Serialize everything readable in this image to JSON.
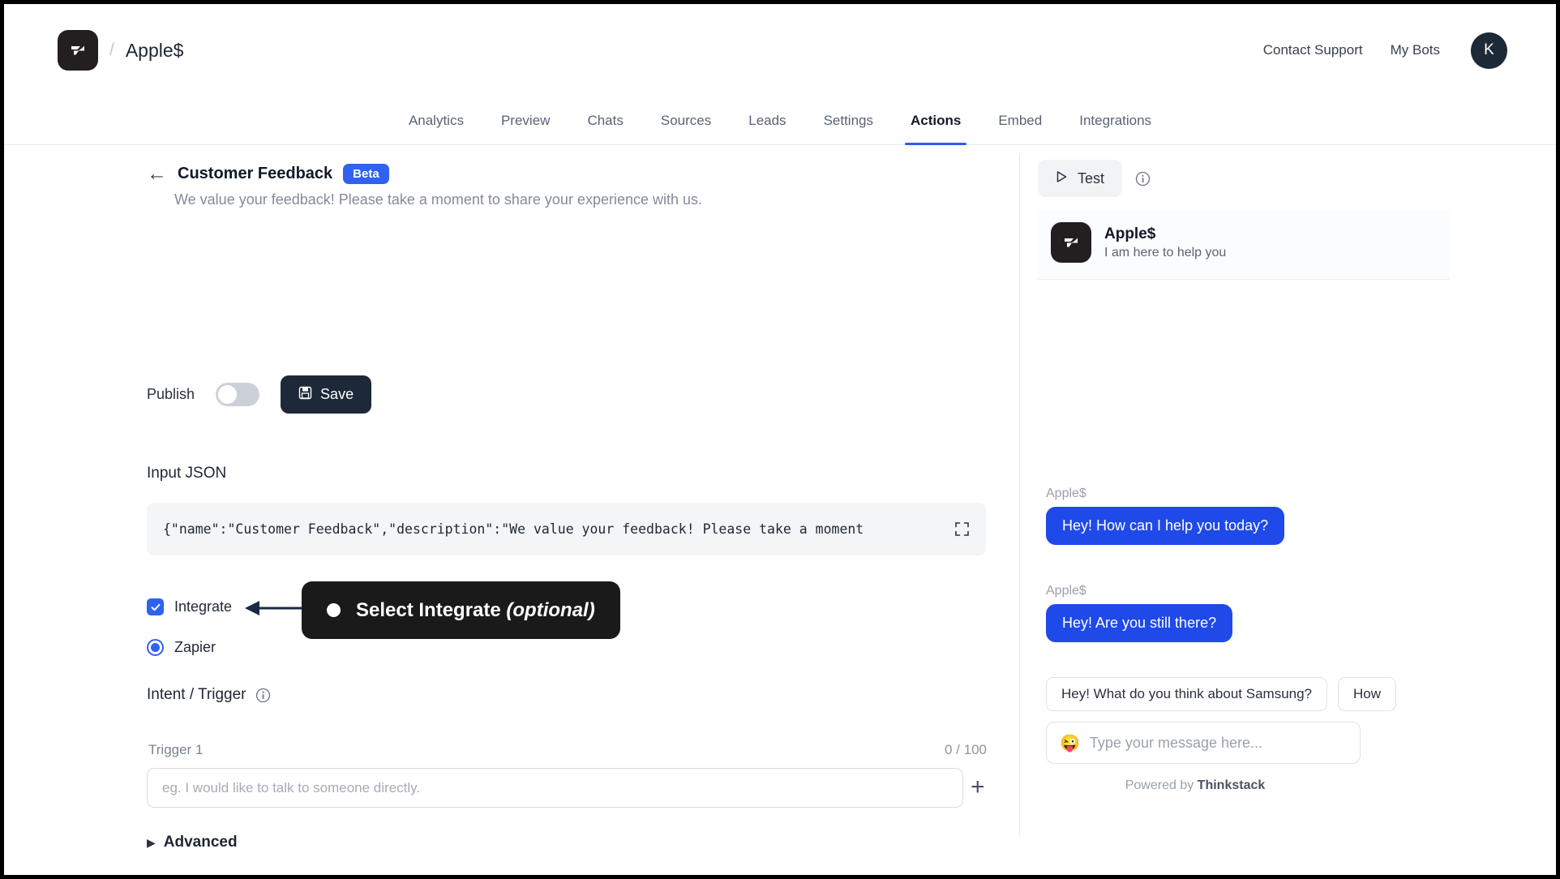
{
  "topbar": {
    "brand_name": "Apple$",
    "separator": "/",
    "logo_icon": "thinkstack-logo-icon",
    "contact_support": "Contact Support",
    "my_bots": "My Bots",
    "avatar_initial": "K"
  },
  "nav": {
    "tabs": [
      {
        "label": "Analytics",
        "active": false
      },
      {
        "label": "Preview",
        "active": false
      },
      {
        "label": "Chats",
        "active": false
      },
      {
        "label": "Sources",
        "active": false
      },
      {
        "label": "Leads",
        "active": false
      },
      {
        "label": "Settings",
        "active": false
      },
      {
        "label": "Actions",
        "active": true
      },
      {
        "label": "Embed",
        "active": false
      },
      {
        "label": "Integrations",
        "active": false
      }
    ]
  },
  "action": {
    "back_arrow": "←",
    "title": "Customer Feedback",
    "badge": "Beta",
    "description": "We value your feedback! Please take a moment to share your experience with us.",
    "publish_label": "Publish",
    "publish_on": false,
    "save_label": "Save",
    "save_icon": "floppy-disk-icon",
    "json_label": "Input JSON",
    "json_value": "{\"name\":\"Customer Feedback\",\"description\":\"We value your feedback! Please take a moment",
    "expand_icon": "expand-fullscreen-icon",
    "integrate_label": "Integrate",
    "integrate_checked": true,
    "zapier_label": "Zapier",
    "zapier_selected": true,
    "intent_label": "Intent / Trigger",
    "info_icon": "info-circle-icon",
    "trigger_label": "Trigger 1",
    "trigger_count": "0 / 100",
    "trigger_value": "",
    "trigger_placeholder": "eg. I would like to talk to someone directly.",
    "add_trigger_icon": "+",
    "advanced_caret": "▶",
    "advanced_label": "Advanced"
  },
  "callout": {
    "text_main": "Select Integrate ",
    "text_em": "(optional)",
    "bullet_icon": "bullet-dot-icon",
    "arrow_icon": "left-arrow-annotation-icon"
  },
  "preview": {
    "test_label": "Test",
    "play_icon": "play-triangle-icon",
    "info_icon": "info-circle-icon",
    "chat": {
      "bot_name": "Apple$",
      "bot_subtitle": "I am here to help you",
      "avatar_icon": "thinkstack-logo-icon",
      "messages": [
        {
          "sender": "Apple$",
          "text": "Hey! How can I help you today?"
        },
        {
          "sender": "Apple$",
          "text": "Hey! Are you still there?"
        }
      ],
      "suggestions": [
        "Hey! What do you think about Samsung?",
        "How"
      ],
      "emoji_icon": "smiley-face-icon",
      "input_placeholder": "Type your message here...",
      "input_value": "",
      "footer_prefix": "Powered by ",
      "footer_brand": "Thinkstack"
    }
  },
  "colors": {
    "accent_blue": "#2f62f0",
    "bubble_blue": "#1f49e8",
    "dark": "#1d2939"
  }
}
